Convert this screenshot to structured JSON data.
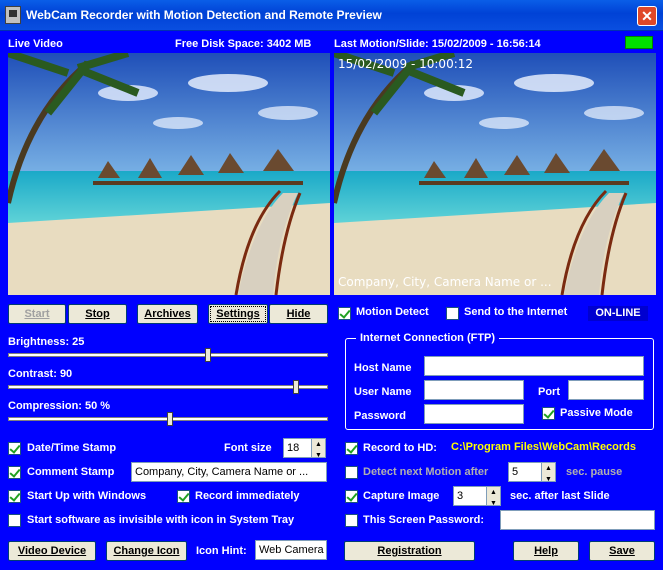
{
  "window": {
    "title": "WebCam Recorder with Motion Detection and Remote Preview",
    "close_label": "✕"
  },
  "header": {
    "live_video_label": "Live Video",
    "disk_space": "Free Disk Space: 3402 MB",
    "last_motion": "Last Motion/Slide:  15/02/2009 - 16:56:14"
  },
  "preview": {
    "timestamp": "15/02/2009 - 10:00:12",
    "comment": "Company, City, Camera Name or ..."
  },
  "buttons": {
    "start": "Start",
    "stop": "Stop",
    "archives": "Archives",
    "settings": "Settings",
    "hide": "Hide",
    "video_device": "Video Device",
    "change_icon": "Change Icon",
    "registration": "Registration",
    "help": "Help",
    "save": "Save"
  },
  "status": {
    "motion_detect": "Motion Detect",
    "send_internet": "Send to the Internet",
    "online": "ON-LINE"
  },
  "sliders": {
    "brightness_label": "Brightness:  25",
    "brightness": 25,
    "contrast_label": "Contrast:  90",
    "contrast": 90,
    "compression_label": "Compression:  50 %",
    "compression": 50
  },
  "options": {
    "datetime_stamp": "Date/Time Stamp",
    "font_size_label": "Font size",
    "font_size": "18",
    "comment_stamp": "Comment Stamp",
    "comment_value": "Company, City, Camera Name or ...",
    "startup_windows": "Start Up with Windows",
    "record_immediately": "Record immediately",
    "start_invisible": "Start software as invisible with icon in System Tray",
    "icon_hint_label": "Icon Hint:",
    "icon_hint_value": "Web Camera"
  },
  "ftp": {
    "title": "Internet Connection (FTP)",
    "host_label": "Host Name",
    "host_value": "",
    "user_label": "User Name",
    "user_value": "",
    "port_label": "Port",
    "port_value": "",
    "password_label": "Password",
    "password_value": "",
    "passive_mode": "Passive Mode"
  },
  "recording": {
    "record_hd": "Record to HD:",
    "record_path": "C:\\Program Files\\WebCam\\Records",
    "detect_next": "Detect next Motion after",
    "detect_value": "5",
    "detect_unit": "sec. pause",
    "capture_image": "Capture Image",
    "capture_value": "3",
    "capture_unit": "sec. after last Slide",
    "screen_password": "This Screen Password:",
    "screen_password_value": ""
  },
  "colors": {
    "background": "#0000ff",
    "online_led": "#00e000",
    "path": "#ffff00"
  }
}
